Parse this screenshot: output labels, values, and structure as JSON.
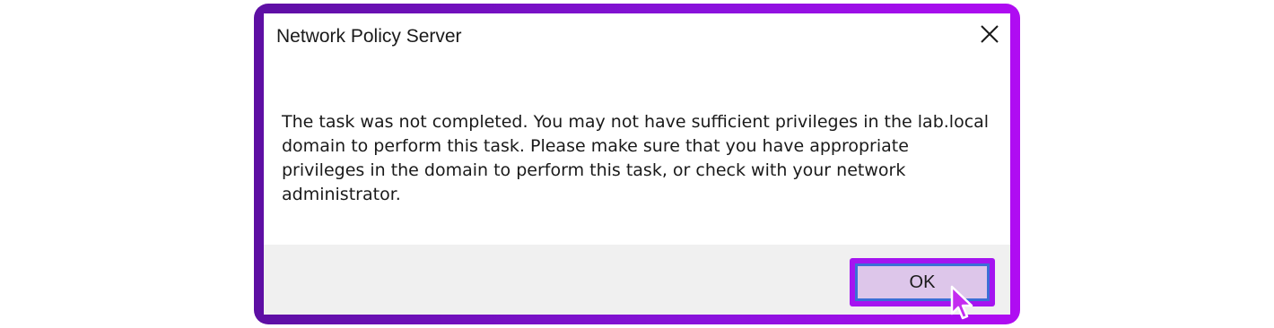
{
  "dialog": {
    "title": "Network Policy Server",
    "message": "The task was not completed. You may not have sufficient privileges in the lab.local domain to perform this task. Please make sure that you have appropriate privileges in the domain to perform this task, or check with your network administrator.",
    "ok_label": "OK",
    "close_icon": "close-icon"
  },
  "colors": {
    "frame_gradient_start": "#5d0fa3",
    "frame_gradient_end": "#b00cf2",
    "ok_highlight": "#a514f0",
    "ok_button_fill": "#ddc6ea",
    "ok_button_border": "#3b6fd6",
    "footer_bg": "#f0f0f0"
  }
}
